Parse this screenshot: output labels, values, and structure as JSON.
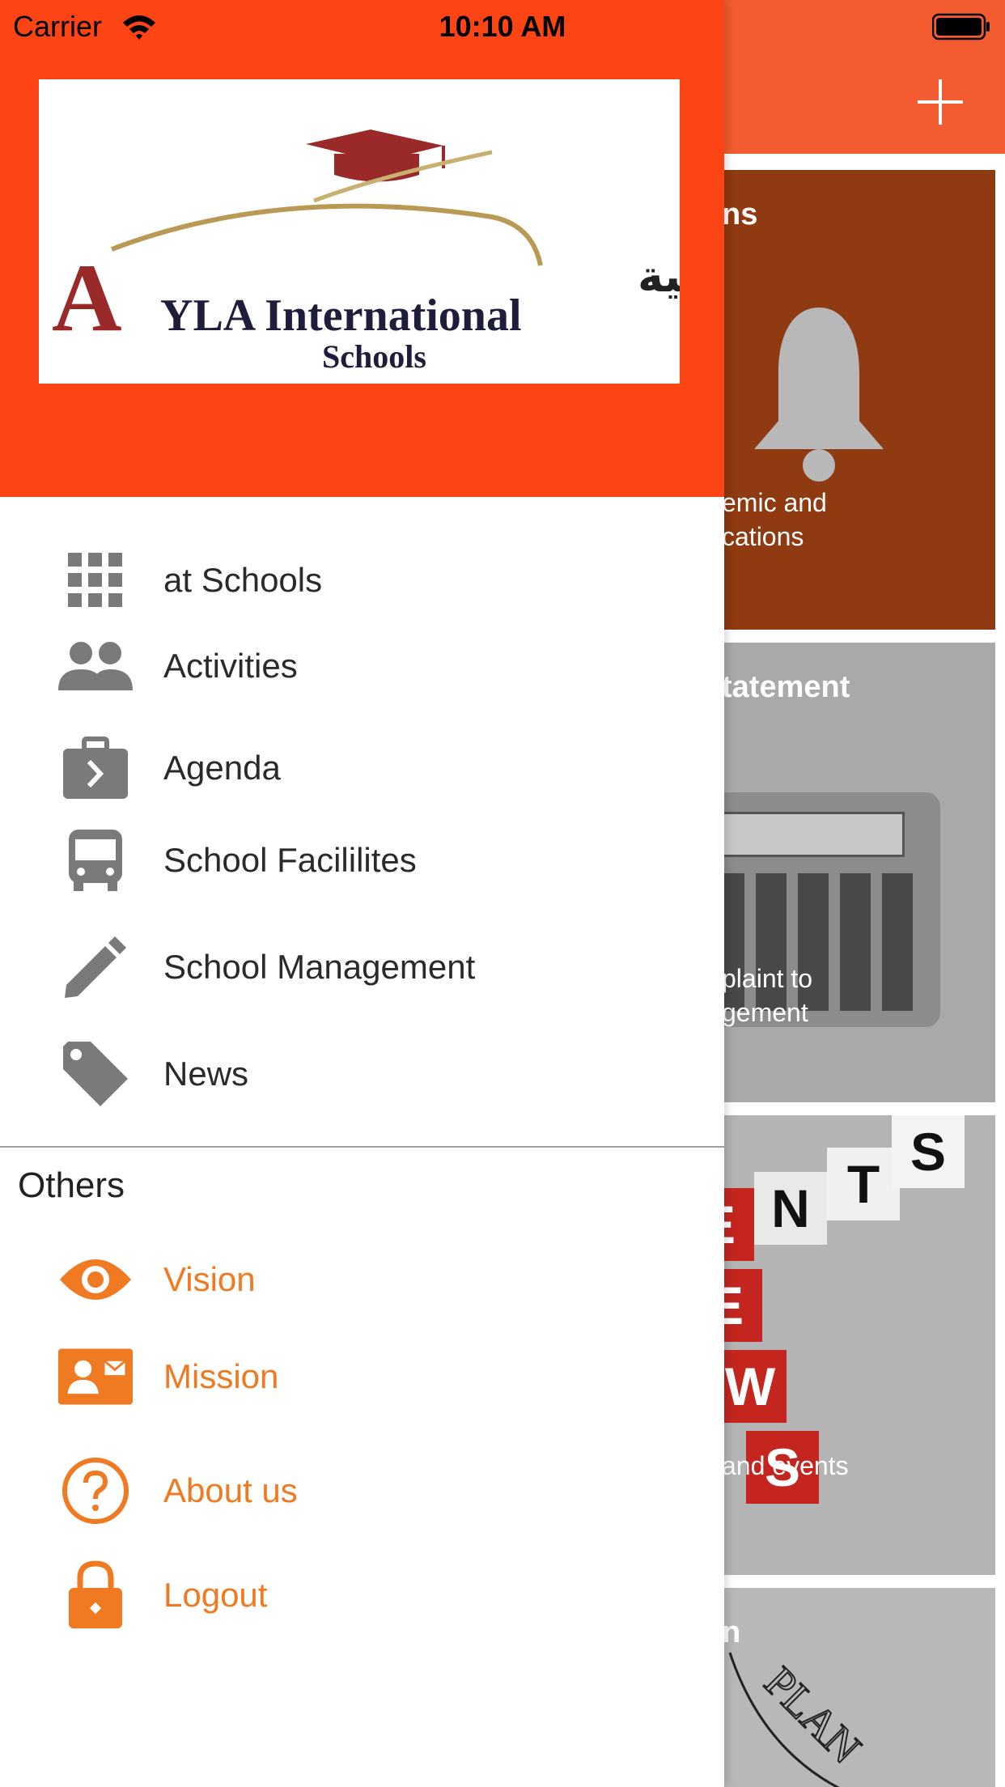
{
  "status_bar": {
    "carrier": "Carrier",
    "time": "10:10 AM"
  },
  "background": {
    "tiles": [
      {
        "title": "ns",
        "caption": "emic and\ncations"
      },
      {
        "title": "tatement",
        "caption": "plaint to\ngement"
      },
      {
        "title": "",
        "caption": "and events"
      },
      {
        "title": "n",
        "caption": ""
      }
    ],
    "news_cubes": [
      "E",
      "N",
      "T",
      "S",
      "E",
      "W",
      "S"
    ],
    "plan_word": "PLAN"
  },
  "drawer": {
    "logo": {
      "arabic_text": "مدارس آيلا العالمية",
      "english_line1": "YLA International",
      "english_line2": "Schools",
      "brand_letter": "A"
    },
    "menu": [
      {
        "label": "at Schools",
        "icon": "grid-icon"
      },
      {
        "label": "Activities",
        "icon": "people-icon"
      },
      {
        "label": "Agenda",
        "icon": "briefcase-icon"
      },
      {
        "label": "School Facililites",
        "icon": "bus-icon"
      },
      {
        "label": "School Management",
        "icon": "pencil-icon"
      },
      {
        "label": "News",
        "icon": "tag-icon"
      }
    ],
    "others_title": "Others",
    "others": [
      {
        "label": "Vision",
        "icon": "eye-icon"
      },
      {
        "label": "Mission",
        "icon": "contact-card-icon"
      },
      {
        "label": "About us",
        "icon": "help-circle-icon"
      },
      {
        "label": "Logout",
        "icon": "lock-icon"
      }
    ]
  },
  "colors": {
    "drawer_header": "#fc4414",
    "nav_bar": "#f25c30",
    "menu_icon_gray": "#7a7a7a",
    "others_orange": "#f07a22"
  }
}
